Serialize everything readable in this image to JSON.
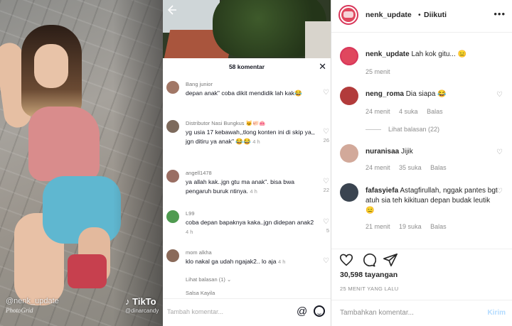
{
  "video": {
    "watermark": "@nenk_update",
    "watermark_sub": "PhotoGrid"
  },
  "phone": {
    "comment_count": "58 komentar",
    "comments": [
      {
        "user": "Bang junior",
        "text": "depan anak\" coba dikit mendidik lah kak",
        "emoji": "😂",
        "time": "",
        "likes": ""
      },
      {
        "user": "Distributor Nasi Bungkus",
        "text": "yg usia 17 kebawah,,tlong konten ini di skip ya,, jgn ditiru ya anak\"",
        "emoji": "😂😂",
        "time": "4 h",
        "likes": "26"
      },
      {
        "user": "angell1478",
        "text": "ya allah kak..jgn gtu ma anak\". bisa bwa pengaruh buruk ntinya.",
        "emoji": "",
        "time": "4 h",
        "likes": "22"
      },
      {
        "user": "L99",
        "text": "coba depan bapaknya kaka..jgn didepan anak2",
        "emoji": "",
        "time": "4 h",
        "likes": "5"
      },
      {
        "user": "mom alkha",
        "text": "klo nakal ga udah ngajak2.. lo aja",
        "emoji": "",
        "time": "4 h",
        "likes": ""
      },
      {
        "user": "Salsa Kayila",
        "text": "",
        "emoji": "",
        "time": "",
        "likes": ""
      }
    ],
    "view_replies": "Lihat balasan (1)",
    "input_placeholder": "Tambah komentar...",
    "tiktok_handle": "@dinarcandy",
    "tiktok_logo": "TikTo"
  },
  "ig": {
    "username": "nenk_update",
    "follow_state": "Diikuti",
    "caption_user": "nenk_update",
    "caption": "Lah kok gitu...",
    "caption_emoji": "😑",
    "caption_time": "25 menit",
    "comments": [
      {
        "user": "neng_roma",
        "text": "Dia siapa",
        "emoji": "😂",
        "time": "24 menit",
        "likes": "4 suka",
        "reply": "Balas",
        "thread": "Lihat balasan (22)"
      },
      {
        "user": "nuranisaa",
        "text": "Jijik",
        "emoji": "",
        "time": "24 menit",
        "likes": "35 suka",
        "reply": "Balas",
        "thread": ""
      },
      {
        "user": "fafasyiefa",
        "text": "Astagfirullah, nggak pantes bgt atuh sia teh kikituan depan budak leutik",
        "emoji": "😑",
        "time": "21 menit",
        "likes": "19 suka",
        "reply": "Balas",
        "thread": ""
      }
    ],
    "views": "30,598 tayangan",
    "posted_ago": "25 MENIT YANG LALU",
    "add_comment_placeholder": "Tambahkan komentar...",
    "post_label": "Kirim"
  },
  "icons": [
    "back-arrow-icon",
    "close-icon",
    "heart-icon",
    "comment-icon",
    "share-icon",
    "at-icon",
    "emoji-icon",
    "more-icon"
  ]
}
